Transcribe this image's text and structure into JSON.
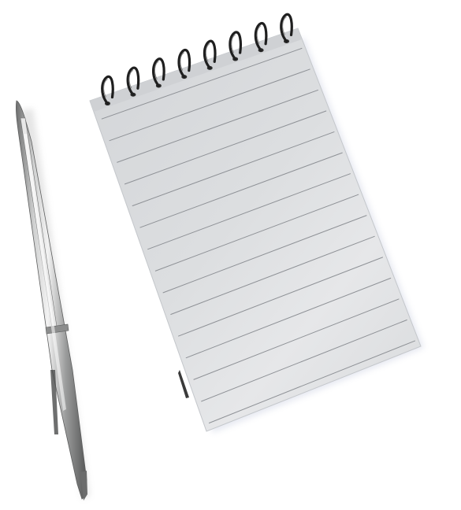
{
  "scene": {
    "background": "#ffffff",
    "objects": [
      {
        "name": "notepad",
        "kind": "spiral-bound-notepad",
        "ruled_lines": 15,
        "spiral_rings": 8,
        "paper_color": "#d9dbdd",
        "line_color": "#8e9196"
      },
      {
        "name": "pen",
        "kind": "ballpoint-pen",
        "body_color": "#b8b9b9"
      }
    ]
  }
}
